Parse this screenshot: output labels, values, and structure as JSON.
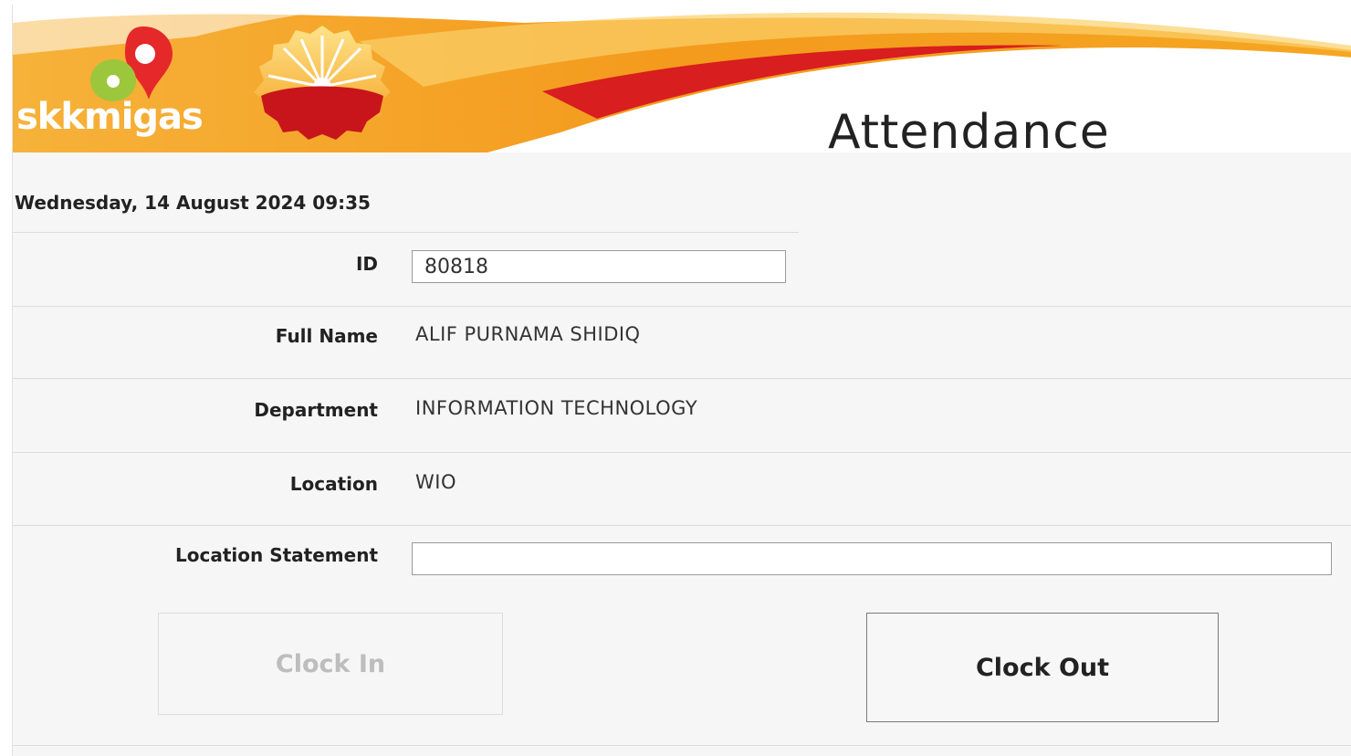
{
  "header": {
    "brand": "skkmigas",
    "title": "Attendance"
  },
  "datetime": "Wednesday, 14 August 2024  09:35",
  "form": {
    "id": {
      "label": "ID",
      "value": "80818"
    },
    "full_name": {
      "label": "Full Name",
      "value": "ALIF PURNAMA SHIDIQ"
    },
    "department": {
      "label": "Department",
      "value": "INFORMATION TECHNOLOGY"
    },
    "location": {
      "label": "Location",
      "value": "WIO"
    },
    "location_statement": {
      "label": "Location Statement",
      "value": ""
    }
  },
  "buttons": {
    "clock_in": {
      "label": "Clock In",
      "state": "disabled"
    },
    "clock_out": {
      "label": "Clock Out",
      "state": "enabled"
    }
  },
  "colors": {
    "banner_orange": "#f39a1e",
    "banner_red": "#d81e1e",
    "logo_green": "#9cc63b",
    "text_dark": "#222222",
    "disabled_text": "#bdbdbd"
  }
}
